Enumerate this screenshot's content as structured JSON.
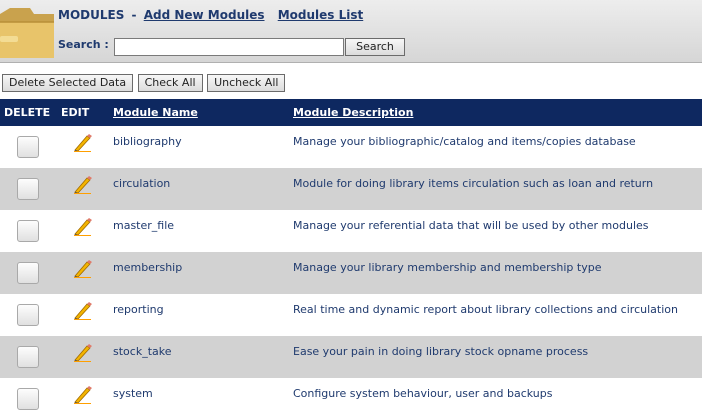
{
  "header": {
    "section_label": "MODULES",
    "separator": "-",
    "nav": [
      "Add New Modules",
      "Modules List"
    ],
    "search_label": "Search :",
    "search_value": "",
    "search_button": "Search"
  },
  "actions": {
    "delete_selected": "Delete Selected Data",
    "check_all": "Check All",
    "uncheck_all": "Uncheck All"
  },
  "table": {
    "columns": {
      "delete": "DELETE",
      "edit": "EDIT",
      "name": "Module Name",
      "description": "Module Description"
    },
    "rows": [
      {
        "name": "bibliography",
        "description": "Manage your bibliographic/catalog and items/copies database"
      },
      {
        "name": "circulation",
        "description": "Module for doing library items circulation such as loan and return"
      },
      {
        "name": "master_file",
        "description": "Manage your referential data that will be used by other modules"
      },
      {
        "name": "membership",
        "description": "Manage your library membership and membership type"
      },
      {
        "name": "reporting",
        "description": "Real time and dynamic report about library collections and circulation"
      },
      {
        "name": "stock_take",
        "description": "Ease your pain in doing library stock opname process"
      },
      {
        "name": "system",
        "description": "Configure system behaviour, user and backups"
      }
    ]
  },
  "icons": {
    "module_icon": "folder-icon",
    "edit_icon": "pencil-icon"
  },
  "colors": {
    "table_header_bg": "#0e2860",
    "alt_row_bg": "#d2d2d2",
    "link_color": "#1f3a6e"
  }
}
